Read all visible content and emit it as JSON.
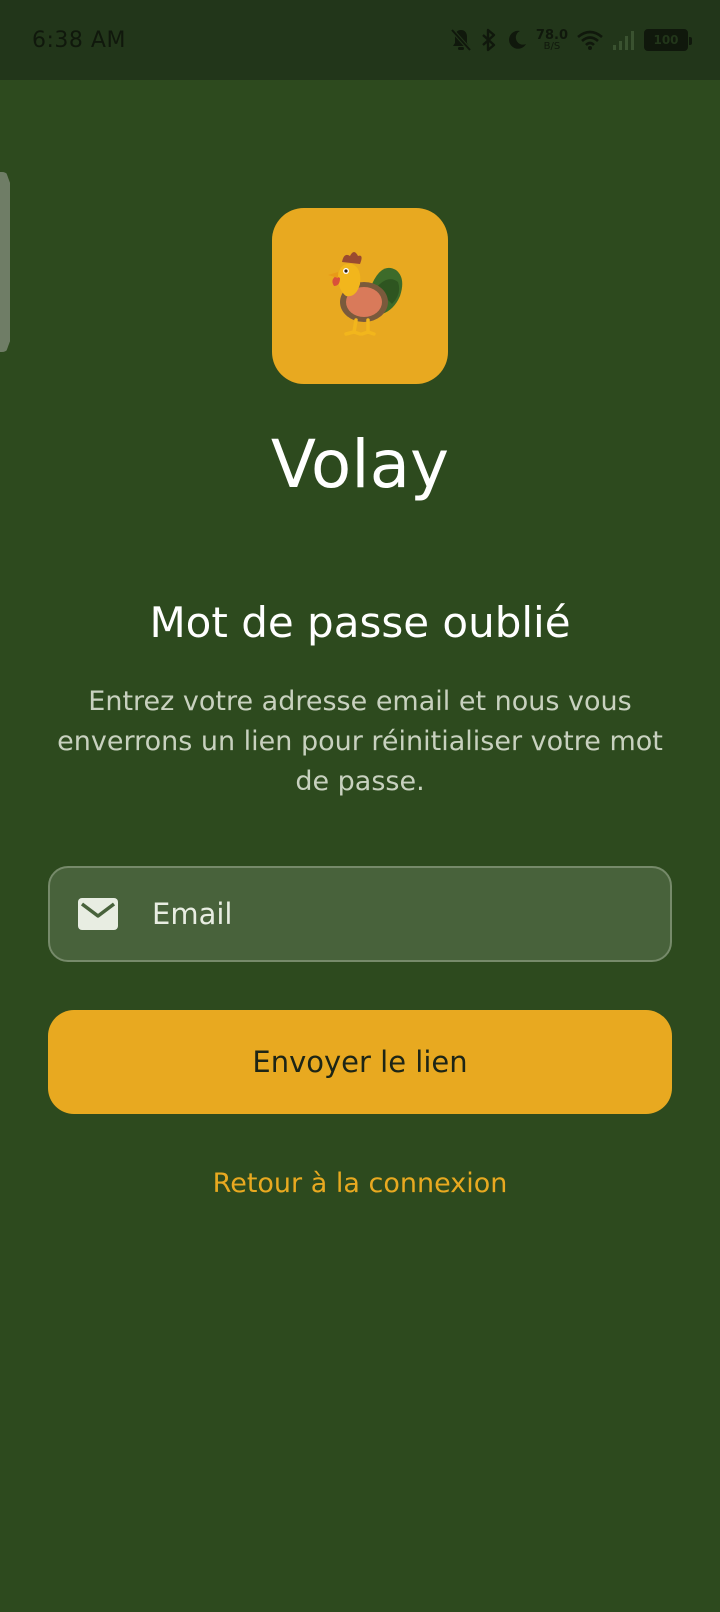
{
  "status_bar": {
    "time": "6:38 AM",
    "net_speed_value": "78.0",
    "net_speed_unit": "B/S",
    "battery": "100",
    "icons": [
      "bell-off-icon",
      "bluetooth-icon",
      "moon-icon",
      "wifi-icon",
      "signal-icon",
      "battery-icon"
    ]
  },
  "app": {
    "logo_icon": "rooster-icon",
    "name": "Volay"
  },
  "screen": {
    "title": "Mot de passe oublié",
    "description": "Entrez votre adresse email et nous vous enverrons un lien pour réinitialiser votre mot de passe."
  },
  "form": {
    "email_placeholder": "Email",
    "email_value": "",
    "email_icon": "mail-icon",
    "submit_label": "Envoyer le lien"
  },
  "footer": {
    "back_label": "Retour à la connexion"
  },
  "colors": {
    "background": "#2d4a1e",
    "accent": "#e8a920",
    "input_background": "#48623b"
  }
}
